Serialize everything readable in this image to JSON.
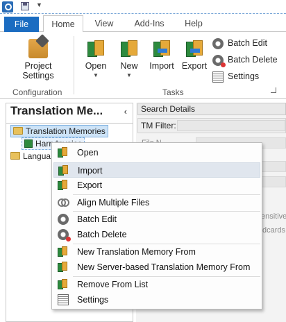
{
  "ribbon": {
    "tabs": [
      {
        "label": "File"
      },
      {
        "label": "Home"
      },
      {
        "label": "View"
      },
      {
        "label": "Add-Ins"
      },
      {
        "label": "Help"
      }
    ],
    "groups": {
      "configuration": {
        "label": "Configuration",
        "project_settings": {
          "line1": "Project",
          "line2": "Settings"
        }
      },
      "tasks": {
        "label": "Tasks",
        "open": "Open",
        "new": "New",
        "import": "Import",
        "export": "Export",
        "batch_edit": "Batch Edit",
        "batch_delete": "Batch Delete",
        "settings": "Settings"
      }
    }
  },
  "left_pane": {
    "title": "Translation  Me...",
    "collapse_glyph": "‹",
    "tree": [
      {
        "label": "Translation Memories"
      },
      {
        "label": "HarryInvoice"
      },
      {
        "label": "Langua"
      }
    ]
  },
  "right_pane": {
    "header": "Search Details",
    "filter_label": "TM Filter:",
    "ghost1": "File  N",
    "ghost2": "ensitive",
    "ghost3": "dcards"
  },
  "context_menu": {
    "items": [
      {
        "label": "Open",
        "icon": "open-tm-icon",
        "underline": "O",
        "rest": "pen"
      },
      {
        "label": "Import",
        "icon": "import-icon",
        "underline": "I",
        "rest": "mport"
      },
      {
        "label": "Export",
        "icon": "export-icon",
        "pre": "Ex",
        "underline": "p",
        "rest": "ort"
      },
      {
        "label": "Align Multiple Files",
        "icon": "align-icon",
        "underline": "A",
        "rest": "lign Multiple Files"
      },
      {
        "label": "Batch Edit",
        "icon": "gear-icon",
        "underline": "B",
        "rest": "atch Edit"
      },
      {
        "label": "Batch Delete",
        "icon": "gear-delete-icon",
        "pre": "Batch ",
        "underline": "D",
        "rest": "elete"
      },
      {
        "label": "New Translation Memory From",
        "icon": "new-tm-icon"
      },
      {
        "label": "New Server-based Translation Memory From",
        "icon": "new-server-tm-icon"
      },
      {
        "label": "Remove From List",
        "icon": "remove-icon"
      },
      {
        "label": "Settings",
        "icon": "settings-icon",
        "underline": "S",
        "rest": "ettings"
      }
    ]
  },
  "colors": {
    "file_tab": "#1b6cc1",
    "highlight": "#e0e6ee",
    "tree_selection": "#cde3f7"
  }
}
